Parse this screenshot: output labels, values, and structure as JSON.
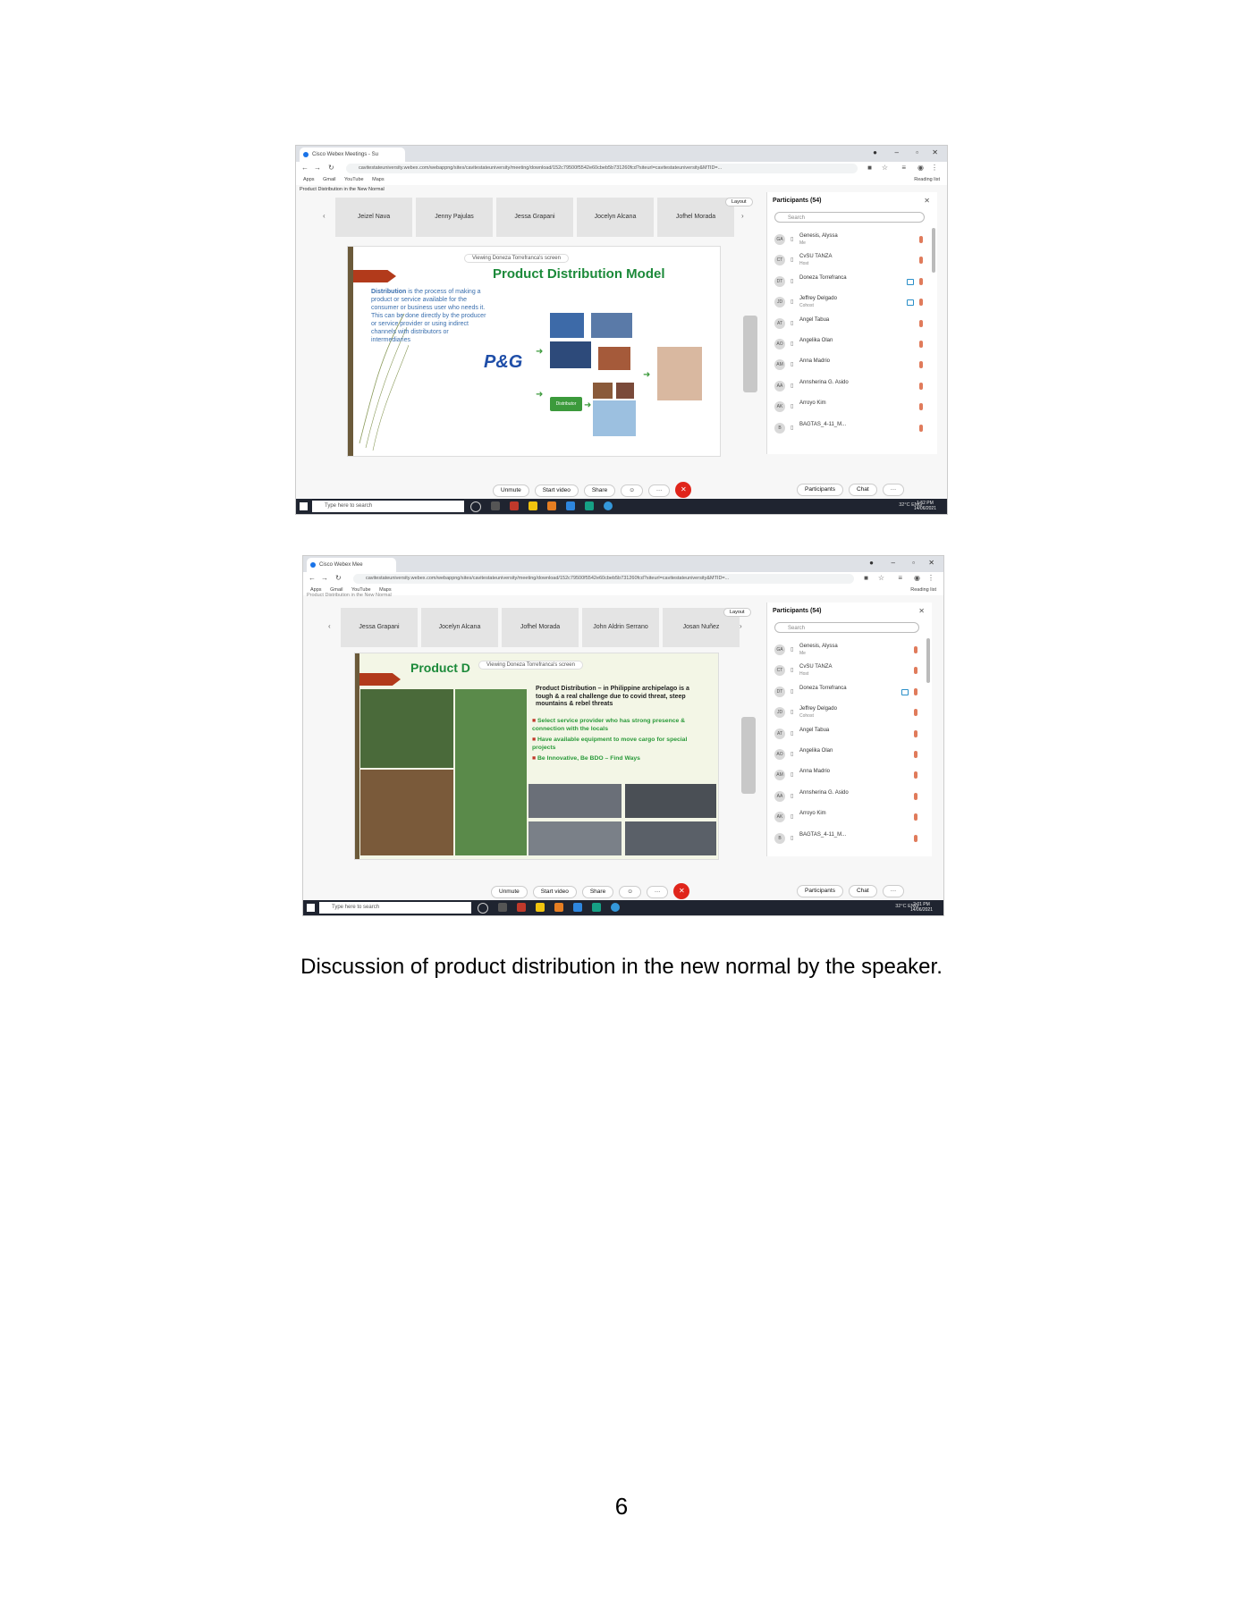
{
  "shot1": {
    "tab_title": "Cisco Webex Meetings - Su",
    "url": "cavitestateuniversity.webex.com/webappng/sites/cavitestateuniversity/meeting/download/152c79500f5542e60cbeb5b731260fcd?siteurl=cavitestateuniversity&MTID=...",
    "bookmarks": [
      "Apps",
      "Gmail",
      "YouTube",
      "Maps"
    ],
    "reading_list": "Reading list",
    "meeting_title": "Product Distribution in the New Normal",
    "video_tiles": [
      "Jeizel Nava",
      "Jenny Pajulas",
      "Jessa Grapani",
      "Jocelyn Alcana",
      "Jofhel Morada"
    ],
    "layout_label": "Layout",
    "viewing_label": "Viewing Doneza Torrefranca's screen",
    "slide": {
      "title": "Product Distribution Model",
      "body_lead": "Distribution",
      "body": "is the process of making a product or service available for the consumer or business user who needs it. This can be done directly by the producer or service provider or using indirect channels with distributors or intermediaries",
      "logo": "P&G",
      "distributor_label": "Distributor"
    },
    "participants_title": "Participants (54)",
    "search_placeholder": "Search",
    "participants": [
      {
        "initials": "GA",
        "name": "Genesis, Alyssa",
        "sub": "Me",
        "cam": false
      },
      {
        "initials": "CT",
        "name": "CvSU TANZA",
        "sub": "Host",
        "cam": false
      },
      {
        "initials": "DT",
        "name": "Doneza Torrefranca",
        "sub": "",
        "cam": true
      },
      {
        "initials": "JD",
        "name": "Jeffrey Delgado",
        "sub": "Cohost",
        "cam": true
      },
      {
        "initials": "AT",
        "name": "Angel Tabua",
        "sub": "",
        "cam": false
      },
      {
        "initials": "AO",
        "name": "Angelika Olan",
        "sub": "",
        "cam": false
      },
      {
        "initials": "AM",
        "name": "Anna Madrio",
        "sub": "",
        "cam": false
      },
      {
        "initials": "AA",
        "name": "Annsherina G. Asido",
        "sub": "",
        "cam": false
      },
      {
        "initials": "AK",
        "name": "Arroyo Kim",
        "sub": "",
        "cam": false
      },
      {
        "initials": "B",
        "name": "BAGTAS_4-11_M...",
        "sub": "",
        "cam": false
      }
    ],
    "controls": {
      "unmute": "Unmute",
      "start_video": "Start video",
      "share": "Share",
      "participants": "Participants",
      "chat": "Chat"
    },
    "taskbar_search": "Type here to search",
    "tray": "32°C  ENG",
    "time": "1:52 PM",
    "date": "14/06/2021"
  },
  "shot2": {
    "tab_title": "Cisco Webex Mee",
    "url": "cavitestateuniversity.webex.com/webappng/sites/cavitestateuniversity/meeting/download/152c79500f5542e60cbeb5b731260fcd?siteurl=cavitestateuniversity&MTID=...",
    "bookmarks": [
      "Apps",
      "Gmail",
      "YouTube",
      "Maps"
    ],
    "reading_list": "Reading list",
    "meeting_title": "Product Distribution in the New Normal",
    "video_tiles": [
      "Jessa Grapani",
      "Jocelyn Alcana",
      "Jofhel Morada",
      "John Aldrin Serrano",
      "Josan Nuñez"
    ],
    "layout_label": "Layout",
    "viewing_label": "Viewing Doneza Torrefranca's screen",
    "slide": {
      "title": "Product D",
      "intro": "Product Distribution – in Philippine archipelago is a tough & a real challenge due to covid threat, steep mountains & rebel threats",
      "bullets": [
        "Select service provider who has strong presence & connection with the locals",
        "Have available equipment to move cargo for special projects",
        "Be Innovative, Be BDO – Find Ways"
      ]
    },
    "participants_title": "Participants (54)",
    "search_placeholder": "Search",
    "participants": [
      {
        "initials": "GA",
        "name": "Genesis, Alyssa",
        "sub": "Me",
        "cam": false
      },
      {
        "initials": "CT",
        "name": "CvSU TANZA",
        "sub": "Host",
        "cam": false
      },
      {
        "initials": "DT",
        "name": "Doneza Torrefranca",
        "sub": "",
        "cam": true
      },
      {
        "initials": "JD",
        "name": "Jeffrey Delgado",
        "sub": "Cohost",
        "cam": false
      },
      {
        "initials": "AT",
        "name": "Angel Tabua",
        "sub": "",
        "cam": false
      },
      {
        "initials": "AO",
        "name": "Angelika Olan",
        "sub": "",
        "cam": false
      },
      {
        "initials": "AM",
        "name": "Anna Madrio",
        "sub": "",
        "cam": false
      },
      {
        "initials": "AA",
        "name": "Annsherina G. Asido",
        "sub": "",
        "cam": false
      },
      {
        "initials": "AK",
        "name": "Arroyo Kim",
        "sub": "",
        "cam": false
      },
      {
        "initials": "B",
        "name": "BAGTAS_4-11_M...",
        "sub": "",
        "cam": false
      }
    ],
    "controls": {
      "unmute": "Unmute",
      "start_video": "Start video",
      "share": "Share",
      "participants": "Participants",
      "chat": "Chat"
    },
    "taskbar_search": "Type here to search",
    "tray": "32°C  ENG",
    "time": "2:01 PM",
    "date": "14/06/2021"
  },
  "caption": "Discussion of product distribution in the new normal by the speaker.",
  "page_number": "6"
}
